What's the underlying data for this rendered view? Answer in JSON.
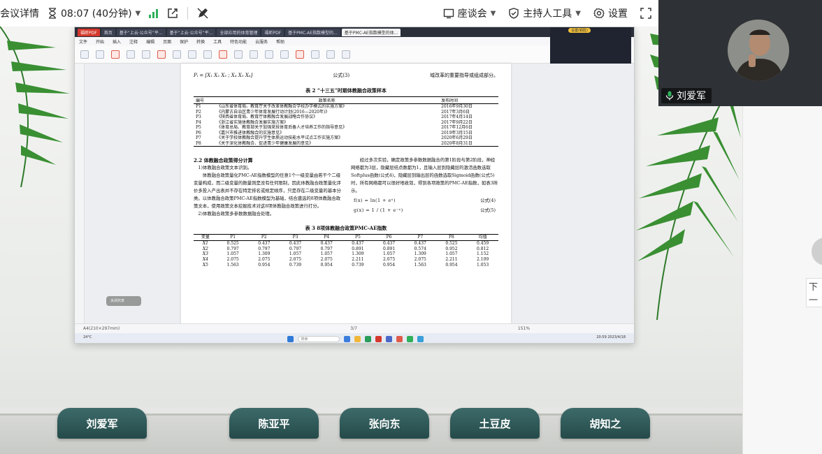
{
  "topbar": {
    "meeting_details": "会议详情",
    "timer": "08:07 (40分钟)",
    "seminar": "座谈会",
    "host_tools": "主持人工具",
    "settings": "设置"
  },
  "participant": {
    "name": "刘爱军"
  },
  "nameplates": [
    "刘爱军",
    "陈亚平",
    "张向东",
    "土豆皮",
    "胡知之"
  ],
  "side_panel": {
    "next_label": "下一"
  },
  "shared_screen": {
    "app_tabs": [
      "福昕PDF",
      "首页",
      "基于“上云·公众号”平...",
      "基于“上云·公众号”平...",
      "全部应用的体育管理",
      "福昕PDF",
      "基于PMC-AE指数模型的...",
      "基于PMC-AE指数模型的体..."
    ],
    "menu": [
      "文件",
      "开始",
      "插入",
      "注释",
      "编辑",
      "页面",
      "保护",
      "转换",
      "工具",
      "特色功能",
      "云服务",
      "帮助"
    ],
    "formula_label": "公式(3)",
    "formula_text": "域改革的重要指导或组成部分。",
    "table2": {
      "title": "表 2 “十三五”时期体教融合政策样本",
      "headers": [
        "编号",
        "政策名称",
        "发布时间"
      ],
      "rows": [
        [
          "P1",
          "《山东省体育局、教育厅关于改革体教融合学校办学模式的实施方案》",
          "2016年9月30日"
        ],
        [
          "P2",
          "《内蒙古自治区青少年体育发展行动计划(2016—2020年)》",
          "2017年3月6日"
        ],
        [
          "P3",
          "《陕西省体育局、教育厅体教融合发展战略合作协议》",
          "2017年4月14日"
        ],
        [
          "P4",
          "《浙江省实施体教融合发展实施方案》",
          "2017年9月22日"
        ],
        [
          "P5",
          "《体育总局、教育部关于加强竞技体育后备人才培养工作的指导意见》",
          "2017年12月6日"
        ],
        [
          "P6",
          "《嘉兴市推进体教融合的实施意见》",
          "2019年3月15日"
        ],
        [
          "P7",
          "《关于学校体教融合提升学生体质运动技能水平试点工作实施方案》",
          "2020年6月29日"
        ],
        [
          "P8",
          "《关于深化体教融合、促进青少年健康发展的意见》",
          "2020年8月31日"
        ]
      ]
    },
    "section_heading": "2.2 体教融合政策得分计算",
    "left_paragraphs": [
      "1)体教融合政策文本识别。",
      "体教融合政策量化PMC-AE指数模型的任意1个一级变量由若干个二级变量构成，而二级变量的数量则是没有任何限制，因此体教融合政策量化评价多投入产出表并不存在特定排名或规定顺序，只是存在二级变量的基本分类。以体教融合政策PMC-AE指数模型为基础，结合遴选的8项体教融合政策文本，使用政策文本挖掘技术对这8项体教融合政策进行打分。",
      "2)体教融合政策多参数数据融合处理。"
    ],
    "right_paragraph": "经过多次实验，确定政策多参数数据融合的第1阶段与第2阶段，神经网络都为3层，隐藏层结点数都为1，且输入层到隐藏层的激活函数选取Softplus函数(公式4)，隐藏层到输出层的函数选取Sigmoid函数(公式5)时，所有网络都可以很好地收敛，得到各项政策的PMC-AE指数，如表3所示。",
    "eq4": {
      "expr": "f(x) = ln(1 + eˣ)",
      "label": "公式(4)"
    },
    "eq5": {
      "expr": "g(x) = 1 / (1 + e⁻ˣ)",
      "label": "公式(5)"
    },
    "table3": {
      "title": "表 3 8项体教融合政策PMC-AE指数",
      "headers": [
        "变量",
        "P1",
        "P2",
        "P3",
        "P4",
        "P5",
        "P6",
        "P7",
        "P8",
        "均值"
      ],
      "rows": [
        [
          "X1",
          "0.525",
          "0.437",
          "0.437",
          "0.437",
          "0.437",
          "0.437",
          "0.437",
          "0.525",
          "0.459"
        ],
        [
          "X2",
          "0.797",
          "0.797",
          "0.797",
          "0.797",
          "0.891",
          "0.891",
          "0.574",
          "0.952",
          "0.812"
        ],
        [
          "X3",
          "1.057",
          "1.309",
          "1.057",
          "1.057",
          "1.309",
          "1.057",
          "1.309",
          "1.057",
          "1.152"
        ],
        [
          "X4",
          "2.075",
          "2.075",
          "2.075",
          "2.075",
          "2.211",
          "2.075",
          "2.075",
          "2.211",
          "2.109"
        ],
        [
          "X5",
          "1.563",
          "0.954",
          "0.739",
          "0.954",
          "0.739",
          "0.954",
          "1.563",
          "0.954",
          "1.053"
        ]
      ]
    },
    "status": {
      "page_size": "A4(210×297mm)",
      "page_nav": "3/7",
      "zoom": "151%"
    },
    "taskbar": {
      "search": "搜索",
      "weather": "24°C",
      "time": "20:59",
      "date": "2023/4/18"
    },
    "mini_badge": "设置(钥匙)",
    "chip": "关闭共享"
  },
  "colors": {
    "signal": "#2fb05a",
    "nameplate": "#2f5c5b",
    "brand_red": "#d4382c"
  }
}
